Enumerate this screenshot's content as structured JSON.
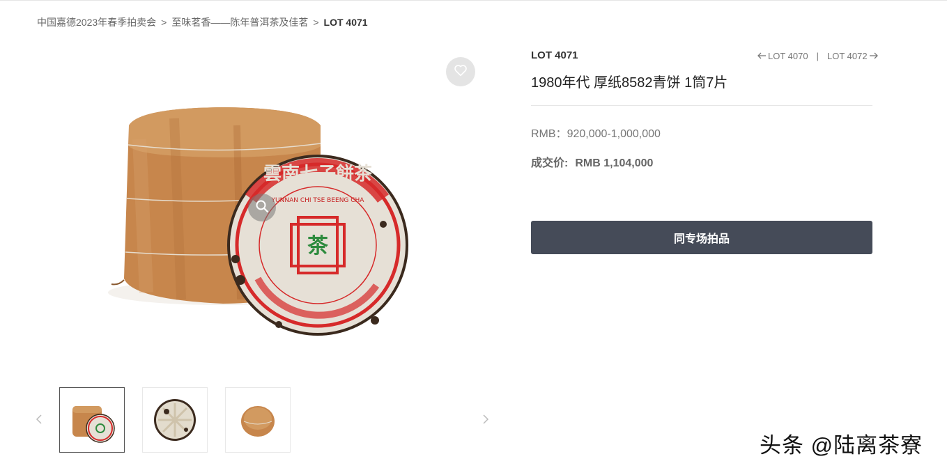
{
  "breadcrumb": {
    "items": [
      "中国嘉德2023年春季拍卖会",
      "至味茗香——陈年普洱茶及佳茗"
    ],
    "current": "LOT 4071",
    "separator": ">"
  },
  "lot": {
    "number": "LOT 4071",
    "prev": "LOT 4070",
    "next": "LOT 4072",
    "nav_divider": "|",
    "title": "1980年代 厚纸8582青饼 1筒7片",
    "estimate_label": "RMB：",
    "estimate_value": "920,000-1,000,000",
    "sold_label": "成交价:",
    "sold_value": "RMB 1,104,000"
  },
  "cta": {
    "label": "同专场拍品"
  },
  "product": {
    "seal_text": "雲南七子餅茶",
    "seal_latin": "YUNNAN CHI TSE BEENG CHA",
    "center_char": "茶"
  },
  "thumbnails": [
    {
      "name": "thumb-1",
      "active": true
    },
    {
      "name": "thumb-2",
      "active": false
    },
    {
      "name": "thumb-3",
      "active": false
    }
  ],
  "icons": {
    "favorite": "heart-icon",
    "zoom": "zoom-icon",
    "prev": "chevron-left-icon",
    "next": "chevron-right-icon",
    "arrow_left": "arrow-left-icon",
    "arrow_right": "arrow-right-icon"
  },
  "colors": {
    "button_bg": "#454b58",
    "seal_red": "#d62a2a",
    "seal_green": "#2e8b3e",
    "wrapper": "#c8844a"
  },
  "watermark": {
    "text": "头条 @陆离茶寮"
  }
}
